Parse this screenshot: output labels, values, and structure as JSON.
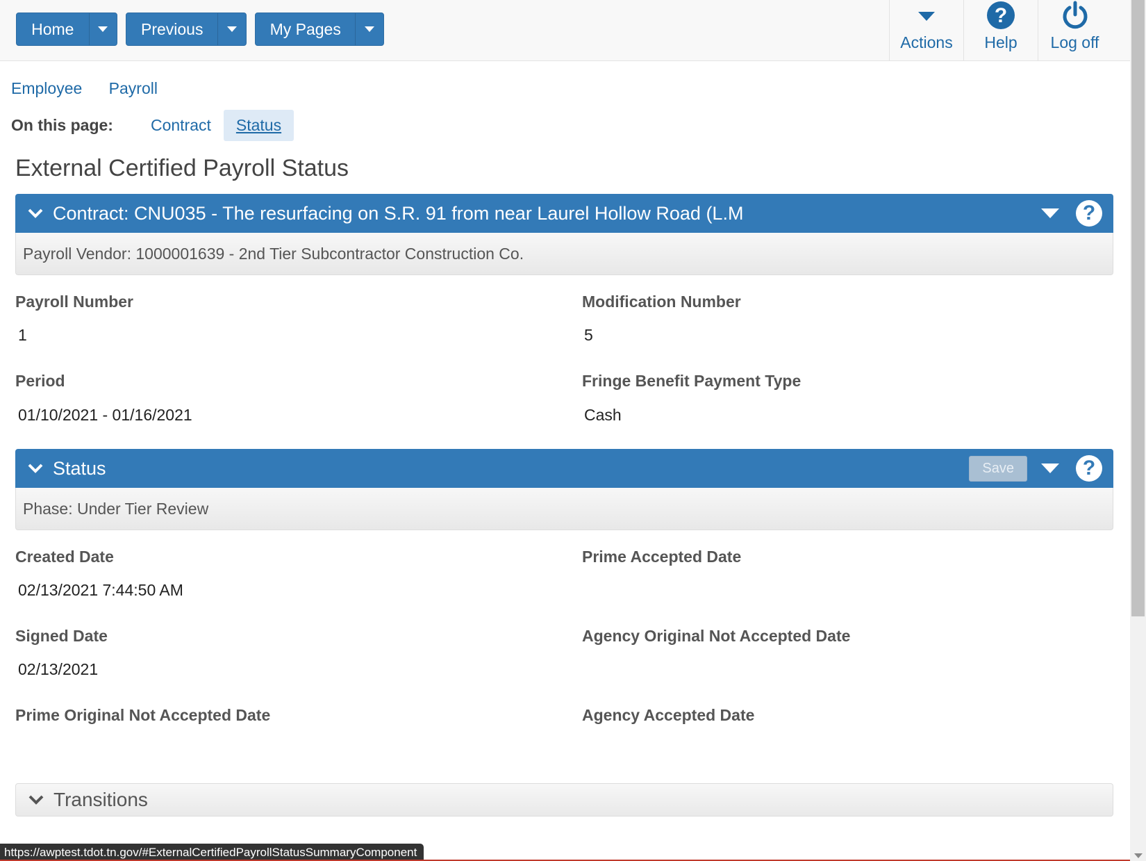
{
  "nav": {
    "home": "Home",
    "previous": "Previous",
    "my_pages": "My Pages"
  },
  "top_actions": {
    "actions": "Actions",
    "help": "Help",
    "logoff": "Log off"
  },
  "breadcrumb": {
    "employee": "Employee",
    "payroll": "Payroll"
  },
  "on_this_page": {
    "label": "On this page:",
    "items": [
      "Contract",
      "Status"
    ],
    "active": "Status"
  },
  "page_title": "External Certified Payroll Status",
  "contract_panel": {
    "title": "Contract: CNU035 - The resurfacing on S.R. 91 from near Laurel Hollow Road (L.M",
    "subtitle": "Payroll Vendor: 1000001639 - 2nd Tier Subcontractor Construction Co."
  },
  "contract_fields": {
    "payroll_number_label": "Payroll Number",
    "payroll_number": "1",
    "modification_number_label": "Modification Number",
    "modification_number": "5",
    "period_label": "Period",
    "period": "01/10/2021 - 01/16/2021",
    "fringe_label": "Fringe Benefit Payment Type",
    "fringe": "Cash"
  },
  "status_panel": {
    "title": "Status",
    "save_label": "Save",
    "subtitle": "Phase: Under Tier Review"
  },
  "status_fields": {
    "created_date_label": "Created Date",
    "created_date": "02/13/2021 7:44:50 AM",
    "prime_accepted_label": "Prime Accepted Date",
    "signed_date_label": "Signed Date",
    "signed_date": "02/13/2021",
    "agency_original_not_accepted_label": "Agency Original Not Accepted Date",
    "prime_original_not_accepted_label": "Prime Original Not Accepted Date",
    "agency_accepted_label": "Agency Accepted Date"
  },
  "transitions_panel": {
    "title": "Transitions"
  },
  "status_bar_url": "https://awptest.tdot.tn.gov/#ExternalCertifiedPayrollStatusSummaryComponent",
  "colors": {
    "primary": "#337ab7",
    "link": "#1f6aa7",
    "active_tab_bg": "#deeaf6"
  }
}
